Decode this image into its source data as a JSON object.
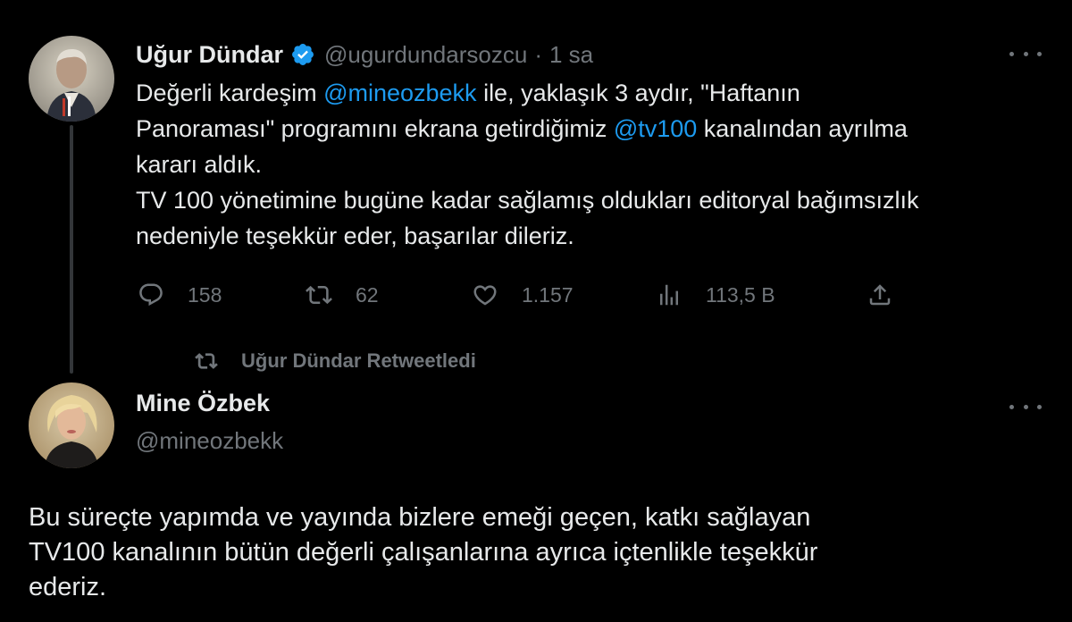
{
  "tweet1": {
    "author_name": "Uğur Dündar",
    "handle": "@ugurdundarsozcu",
    "separator": "·",
    "time": "1 sa",
    "body_lines": [
      [
        "Değerli kardeşim ",
        "@mineozbekk",
        " ile,  yaklaşık 3 aydır, \"Haftanın"
      ],
      [
        "Panoraması\" programını ekrana getirdiğimiz ",
        "@tv100",
        "  kanalından ayrılma"
      ],
      [
        "kararı aldık."
      ],
      [
        "TV 100 yönetimine bugüne kadar sağlamış oldukları editoryal bağımsızlık"
      ],
      [
        "nedeniyle teşekkür eder, başarılar dileriz."
      ]
    ],
    "actions": {
      "replies": "158",
      "retweets": "62",
      "likes": "1.157",
      "views": "113,5 B"
    }
  },
  "retweet_note": "Uğur Dündar Retweetledi",
  "tweet2": {
    "author_name": "Mine Özbek",
    "handle": "@mineozbekk",
    "body_lines": [
      "Bu süreçte yapımda ve yayında bizlere emeği geçen, katkı sağlayan",
      "TV100 kanalının bütün değerli çalışanlarına ayrıca içtenlikle teşekkür",
      "ederiz."
    ]
  },
  "icons": {
    "verified": "verified-badge-icon",
    "reply": "reply-icon",
    "retweet": "retweet-icon",
    "like": "heart-icon",
    "views": "views-icon",
    "share": "share-icon",
    "more": "more-icon"
  },
  "colors": {
    "background": "#000000",
    "text": "#e7e9ea",
    "muted": "#71767b",
    "accent": "#1d9bf0",
    "thread_line": "#333639"
  }
}
